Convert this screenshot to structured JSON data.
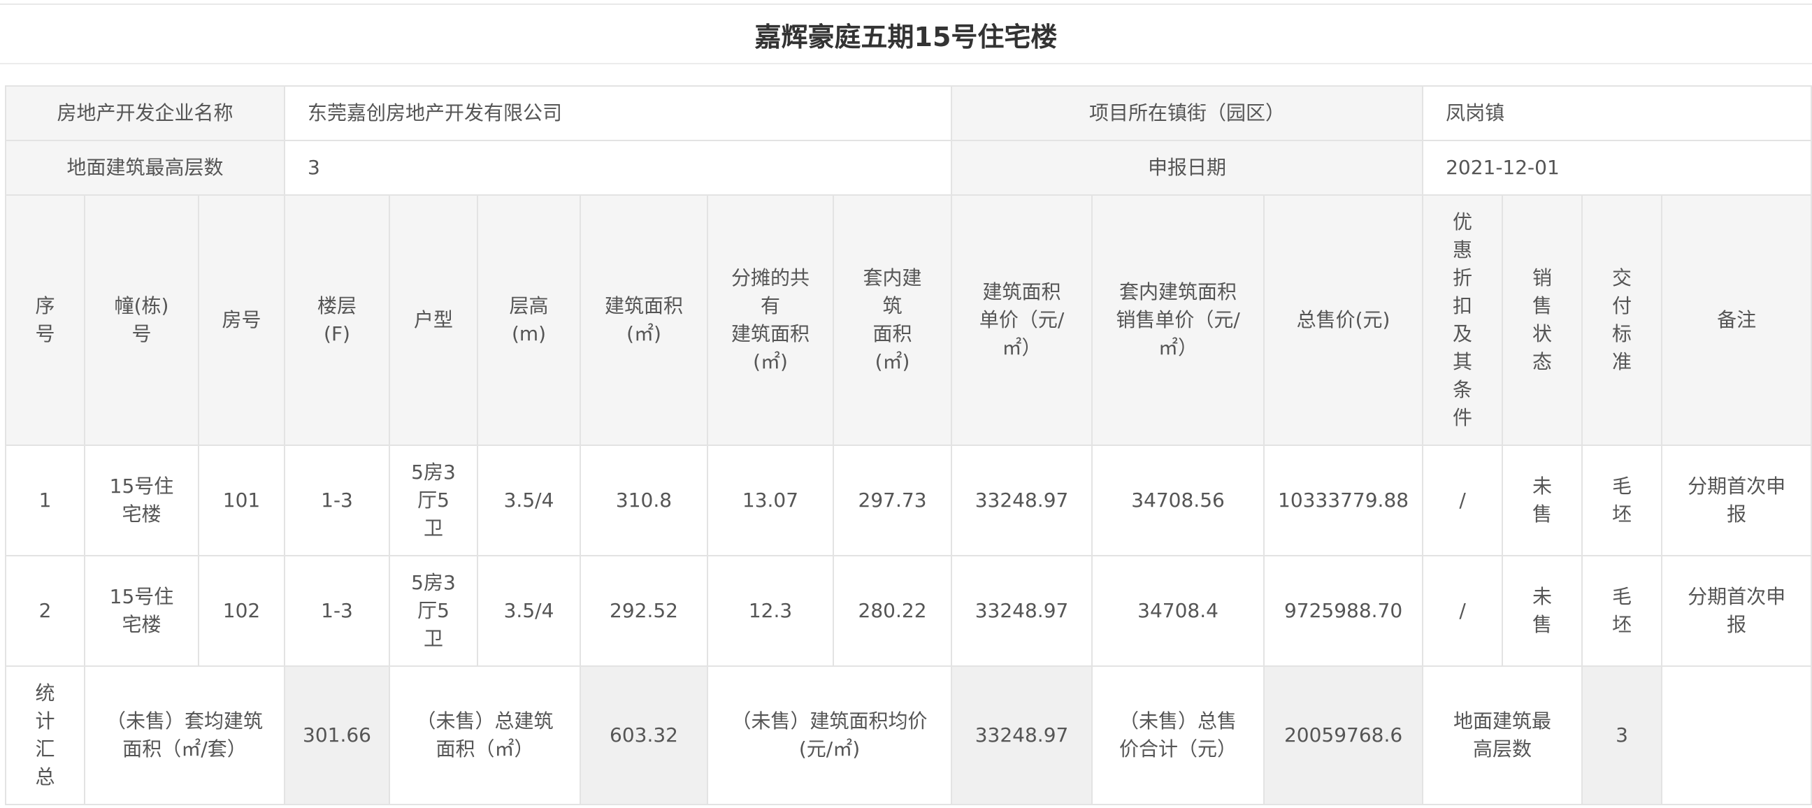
{
  "title": "嘉辉豪庭五期15号住宅楼",
  "info": {
    "developer_label": "房地产开发企业名称",
    "developer_value": "东莞嘉创房地产开发有限公司",
    "town_label": "项目所在镇街（园区）",
    "town_value": "凤岗镇",
    "floors_label": "地面建筑最高层数",
    "floors_value": "3",
    "date_label": "申报日期",
    "date_value": "2021-12-01"
  },
  "columns": [
    "序\n号",
    "幢(栋)\n号",
    "房号",
    "楼层\n(F)",
    "户型",
    "层高\n(m)",
    "建筑面积\n(㎡)",
    "分摊的共\n有\n建筑面积\n(㎡)",
    "套内建\n筑\n面积\n(㎡)",
    "建筑面积\n单价（元/\n㎡）",
    "套内建筑面积\n销售单价（元/\n㎡）",
    "总售价(元)",
    "优\n惠\n折\n扣\n及\n其\n条\n件",
    "销\n售\n状\n态",
    "交\n付\n标\n准",
    "备注"
  ],
  "rows": [
    [
      "1",
      "15号住\n宅楼",
      "101",
      "1-3",
      "5房3\n厅5\n卫",
      "3.5/4",
      "310.8",
      "13.07",
      "297.73",
      "33248.97",
      "34708.56",
      "10333779.88",
      "/",
      "未\n售",
      "毛\n坯",
      "分期首次申\n报"
    ],
    [
      "2",
      "15号住\n宅楼",
      "102",
      "1-3",
      "5房3\n厅5\n卫",
      "3.5/4",
      "292.52",
      "12.3",
      "280.22",
      "33248.97",
      "34708.4",
      "9725988.70",
      "/",
      "未\n售",
      "毛\n坯",
      "分期首次申\n报"
    ]
  ],
  "summary": {
    "label": "统\n计\n汇\n总",
    "avg_area_label": "（未售）套均建筑\n面积（㎡/套）",
    "avg_area_value": "301.66",
    "total_area_label": "（未售）总建筑\n面积（㎡）",
    "total_area_value": "603.32",
    "avg_price_label": "（未售）建筑面积均价\n(元/㎡)",
    "avg_price_value": "33248.97",
    "total_price_label": "（未售）总售\n价合计（元）",
    "total_price_value": "20059768.6",
    "max_floors_label": "地面建筑最\n高层数",
    "max_floors_value": "3",
    "remark_value": ""
  }
}
